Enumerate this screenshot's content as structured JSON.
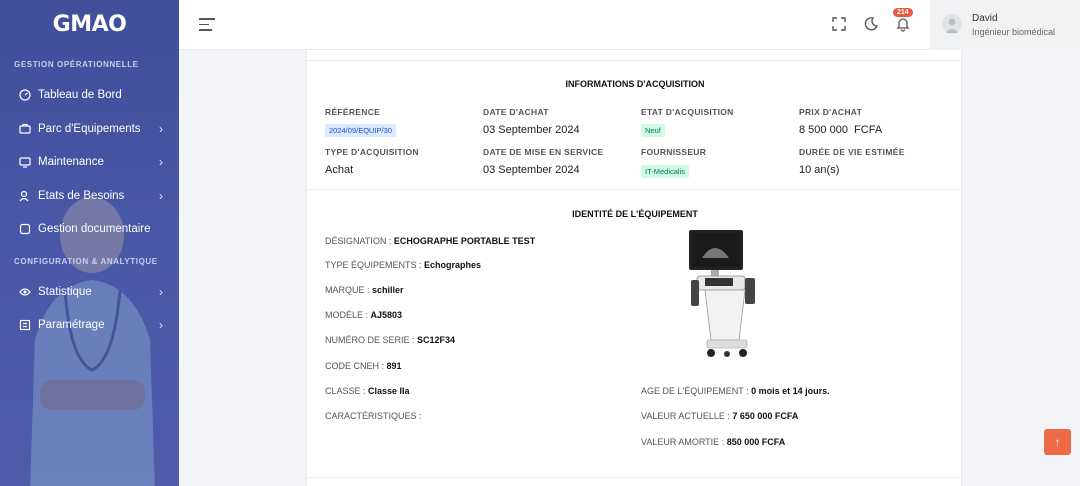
{
  "app": {
    "logo": "GMAO"
  },
  "sidebar": {
    "sections": [
      {
        "title": "GESTION OPÉRATIONNELLE"
      },
      {
        "title": "CONFIGURATION & ANALYTIQUE"
      }
    ],
    "items": [
      {
        "label": "Tableau de Bord",
        "icon": "dashboard-icon",
        "has_submenu": false
      },
      {
        "label": "Parc d'Equipements",
        "icon": "equipment-icon",
        "has_submenu": true
      },
      {
        "label": "Maintenance",
        "icon": "maintenance-icon",
        "has_submenu": true
      },
      {
        "label": "Etats de Besoins",
        "icon": "needs-icon",
        "has_submenu": true
      },
      {
        "label": "Gestion documentaire",
        "icon": "document-icon",
        "has_submenu": false
      },
      {
        "label": "Statistique",
        "icon": "statistics-icon",
        "has_submenu": true
      },
      {
        "label": "Paramétrage",
        "icon": "settings-icon",
        "has_submenu": true
      }
    ],
    "chevron": "›"
  },
  "header": {
    "notifications_count": "214",
    "user": {
      "name": "David",
      "role": "Ingénieur biomédical"
    }
  },
  "acquisition": {
    "title": "INFORMATIONS D'ACQUISITION",
    "fields": {
      "reference": {
        "label": "RÉFÉRENCE",
        "value": "2024/09/EQUIP/30"
      },
      "date_achat": {
        "label": "DATE D'ACHAT",
        "value": "03 September 2024"
      },
      "etat": {
        "label": "ETAT D'ACQUISITION",
        "value": "Neuf"
      },
      "prix": {
        "label": "PRIX D'ACHAT",
        "value": "8 500 000  FCFA"
      },
      "type": {
        "label": "TYPE D'ACQUISITION",
        "value": "Achat"
      },
      "date_service": {
        "label": "DATE DE MISE EN SERVICE",
        "value": "03 September 2024"
      },
      "fournisseur": {
        "label": "FOURNISSEUR",
        "value": "IT-Medicalis"
      },
      "duree": {
        "label": "DURÉE DE VIE ESTIMÉE",
        "value": "10 an(s)"
      }
    }
  },
  "identity": {
    "title": "IDENTITÉ DE L'ÉQUIPEMENT",
    "rows": [
      {
        "label": "DÉSIGNATION : ",
        "value": "ECHOGRAPHE PORTABLE TEST"
      },
      {
        "label": "TYPE ÉQUIPEMENTS : ",
        "value": "Echographes"
      },
      {
        "label": "MARQUE : ",
        "value": "schiller"
      },
      {
        "label": "MODÈLE : ",
        "value": "AJ5803"
      },
      {
        "label": "NUMÉRO DE SERIE : ",
        "value": "SC12F34"
      },
      {
        "label": "CODE CNEH : ",
        "value": "891"
      },
      {
        "label": "CLASSE : ",
        "value": "Classe IIa"
      },
      {
        "label": "CARACTÉRISTIQUES : ",
        "value": ""
      }
    ],
    "right_rows": [
      {
        "label": "AGE DE L'ÉQUIPEMENT : ",
        "value": "0 mois et 14 jours."
      },
      {
        "label": "VALEUR ACTUELLE : ",
        "value": "7 650 000 FCFA"
      },
      {
        "label": "VALEUR AMORTIE : ",
        "value": "850 000 FCFA"
      }
    ]
  },
  "scroll_top": "↑",
  "colors": {
    "sidebar": "#4857a6",
    "accent": "#ef6a47",
    "badge": "#e8573f"
  }
}
